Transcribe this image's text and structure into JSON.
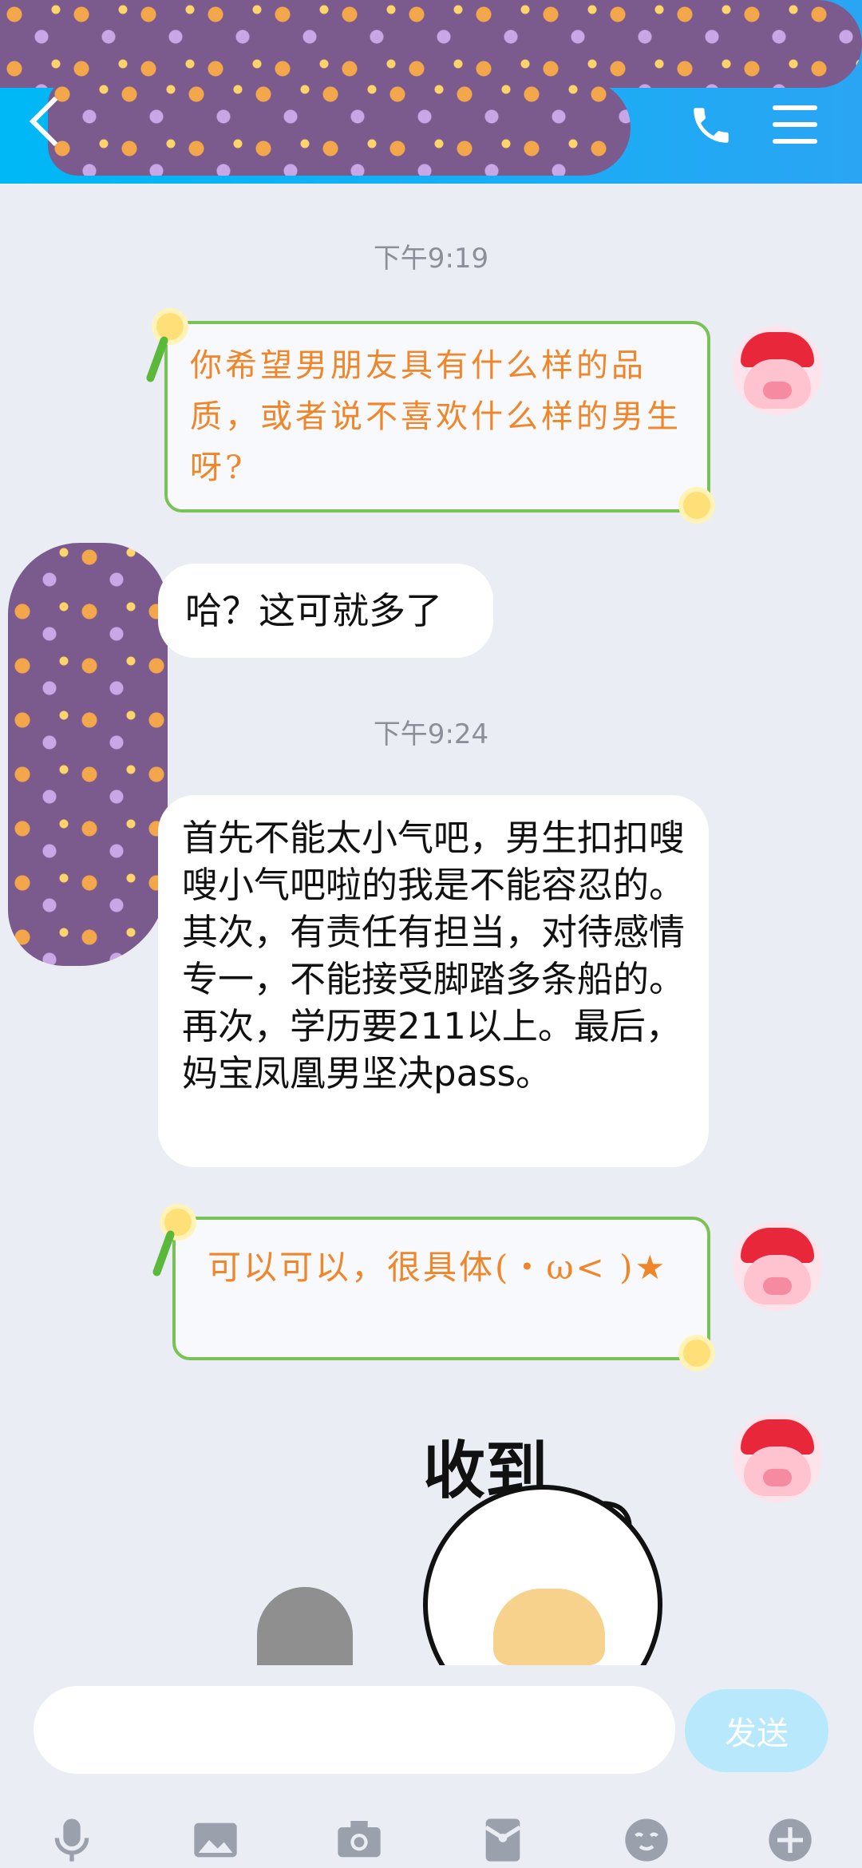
{
  "header": {
    "bg_color": "#2aa5f4"
  },
  "messages": {
    "t1": "下午9:19",
    "m1": "你希望男朋友具有什么样的品质，或者说不喜欢什么样的男生呀?",
    "m2": "哈？这可就多了",
    "t2": "下午9:24",
    "m3": "首先不能太小气吧，男生扣扣嗖嗖小气吧啦的我是不能容忍的。其次，有责任有担当，对待感情专一，不能接受脚踏多条船的。再次，学历要211以上。最后，妈宝凤凰男坚决pass。",
    "m4": "可以可以，很具体(・ω< )★",
    "sticker_text": "收到"
  },
  "input": {
    "placeholder": "",
    "send_label": "发送"
  },
  "toolbar": {
    "icons": [
      "microphone-icon",
      "image-icon",
      "camera-icon",
      "red-packet-icon",
      "emoji-icon",
      "plus-icon"
    ]
  },
  "colors": {
    "card_border": "#79c255",
    "card_text": "#f0862a",
    "send_bg": "#b8e8fb"
  }
}
